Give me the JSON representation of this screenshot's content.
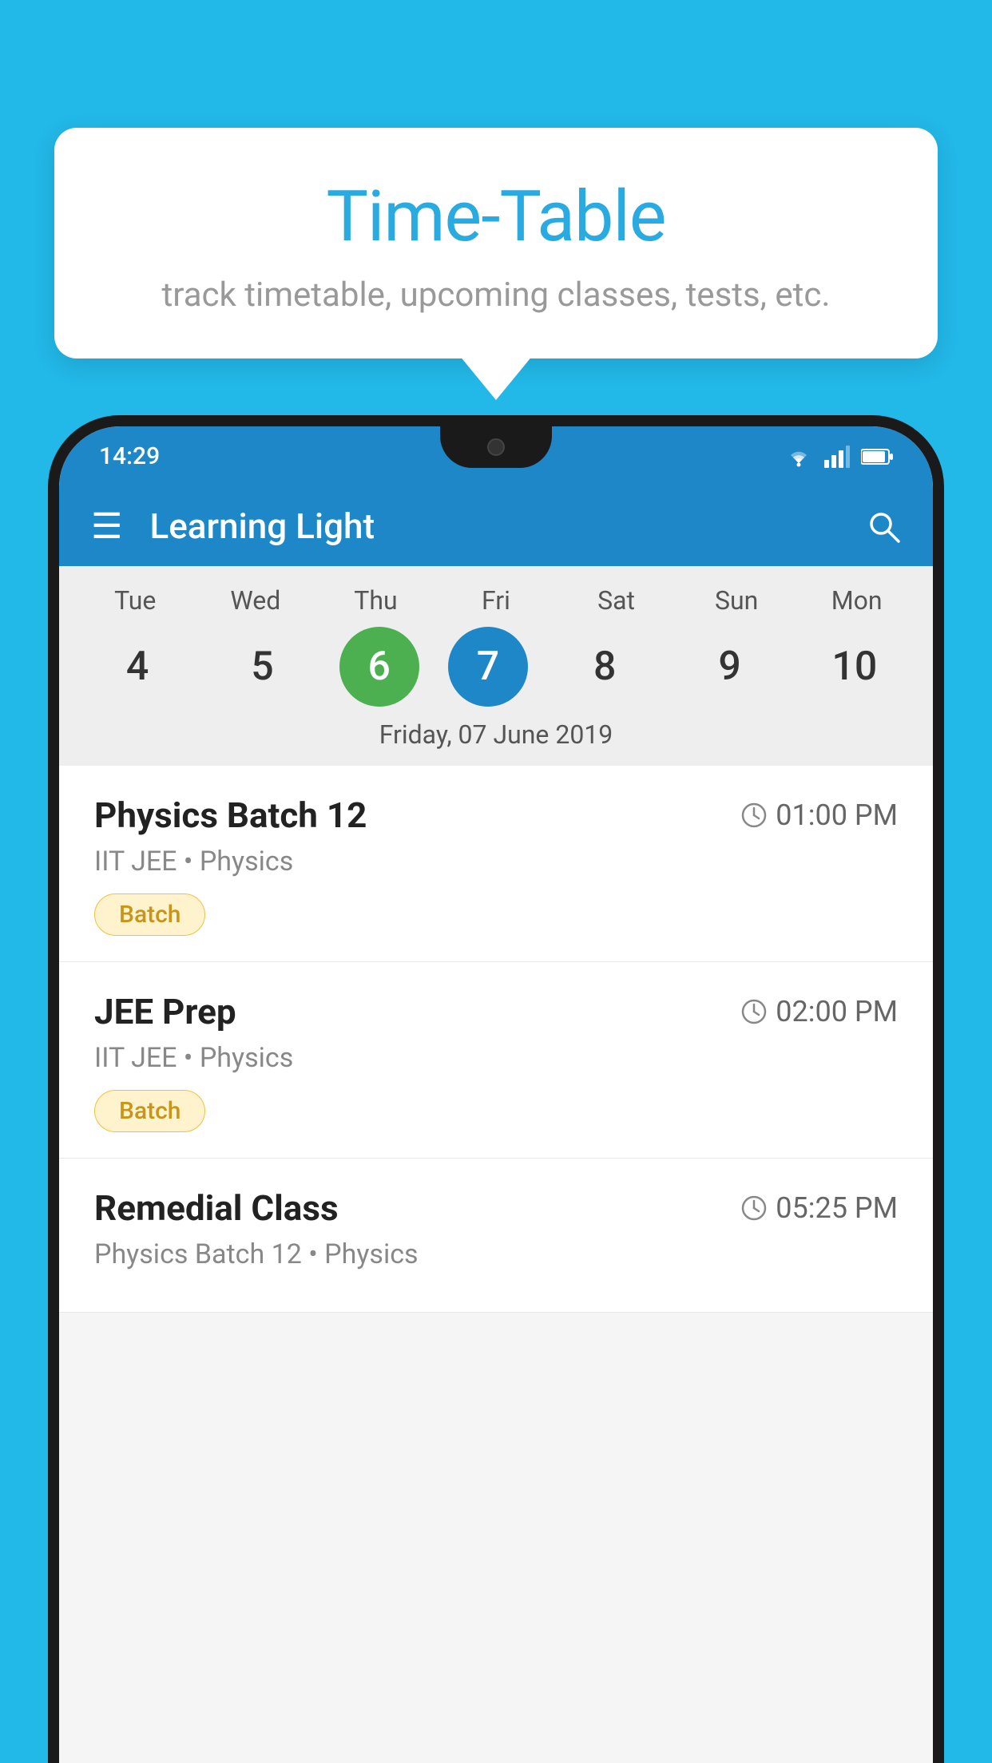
{
  "background_color": "#22b8e8",
  "tooltip": {
    "title": "Time-Table",
    "subtitle": "track timetable, upcoming classes, tests, etc."
  },
  "phone": {
    "status_bar": {
      "time": "14:29",
      "icons": [
        "wifi",
        "signal",
        "battery"
      ]
    },
    "app_bar": {
      "title": "Learning Light",
      "menu_icon": "☰",
      "search_icon": "🔍"
    },
    "calendar": {
      "days": [
        {
          "label": "Tue",
          "number": "4"
        },
        {
          "label": "Wed",
          "number": "5"
        },
        {
          "label": "Thu",
          "number": "6",
          "state": "today"
        },
        {
          "label": "Fri",
          "number": "7",
          "state": "selected"
        },
        {
          "label": "Sat",
          "number": "8"
        },
        {
          "label": "Sun",
          "number": "9"
        },
        {
          "label": "Mon",
          "number": "10"
        }
      ],
      "selected_date_label": "Friday, 07 June 2019"
    },
    "schedule": [
      {
        "title": "Physics Batch 12",
        "time": "01:00 PM",
        "meta": "IIT JEE • Physics",
        "tag": "Batch"
      },
      {
        "title": "JEE Prep",
        "time": "02:00 PM",
        "meta": "IIT JEE • Physics",
        "tag": "Batch"
      },
      {
        "title": "Remedial Class",
        "time": "05:25 PM",
        "meta": "Physics Batch 12 • Physics",
        "tag": ""
      }
    ]
  }
}
